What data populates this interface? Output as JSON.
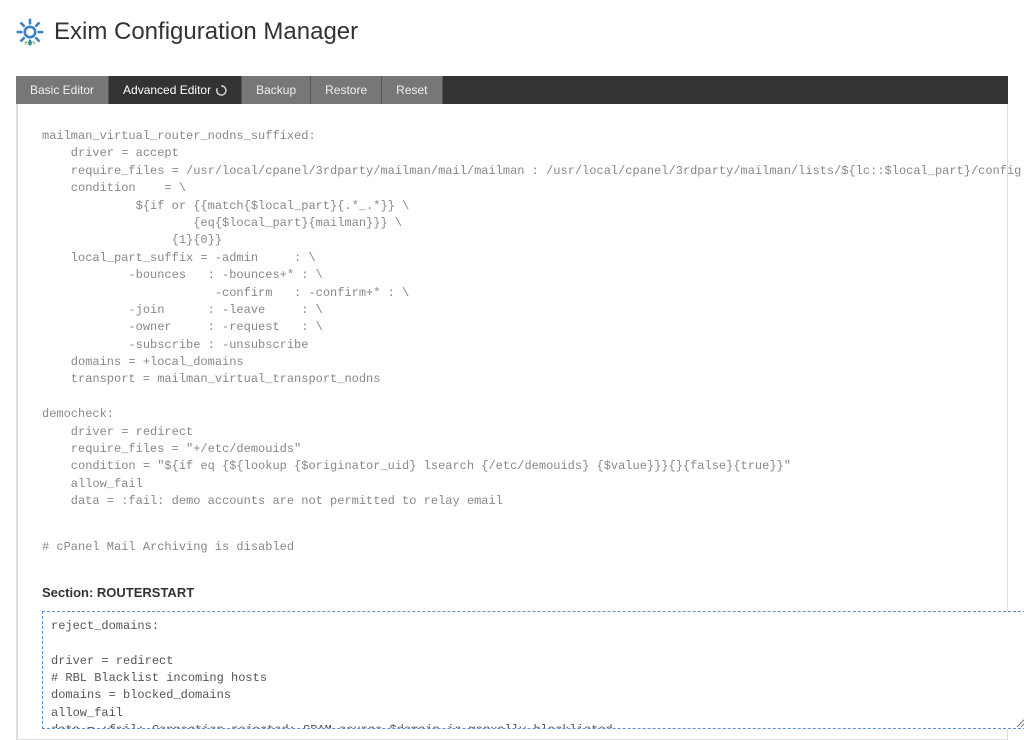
{
  "header": {
    "title": "Exim Configuration Manager",
    "icon": "gear-icon"
  },
  "tabs": [
    {
      "label": "Basic Editor",
      "active": false
    },
    {
      "label": "Advanced Editor",
      "active": true,
      "icon": "refresh-icon"
    },
    {
      "label": "Backup",
      "active": false
    },
    {
      "label": "Restore",
      "active": false
    },
    {
      "label": "Reset",
      "active": false
    }
  ],
  "main": {
    "config_text": "mailman_virtual_router_nodns_suffixed:\n    driver = accept\n    require_files = /usr/local/cpanel/3rdparty/mailman/mail/mailman : /usr/local/cpanel/3rdparty/mailman/lists/${lc::$local_part}/config.pck\n    condition    = \\\n             ${if or {{match{$local_part}{.*_.*}} \\\n                     {eq{$local_part}{mailman}}} \\\n                  {1}{0}}\n    local_part_suffix = -admin     : \\\n            -bounces   : -bounces+* : \\\n                        -confirm   : -confirm+* : \\\n            -join      : -leave     : \\\n            -owner     : -request   : \\\n            -subscribe : -unsubscribe\n    domains = +local_domains\n    transport = mailman_virtual_transport_nodns\n\ndemocheck:\n    driver = redirect\n    require_files = \"+/etc/demouids\"\n    condition = \"${if eq {${lookup {$originator_uid} lsearch {/etc/demouids} {$value}}}{}{false}{true}}\"\n    allow_fail\n    data = :fail: demo accounts are not permitted to relay email",
    "comment_line": "# cPanel Mail Archiving is disabled",
    "section_heading": "Section: ROUTERSTART",
    "editor_value": "reject_domains:\n\ndriver = redirect\n# RBL Blacklist incoming hosts\ndomains = blocked_domains\nallow_fail\ndata = :fail: Connection rejected: SPAM source $domain is manually blacklisted.",
    "status_icon": "check-circle-icon"
  }
}
